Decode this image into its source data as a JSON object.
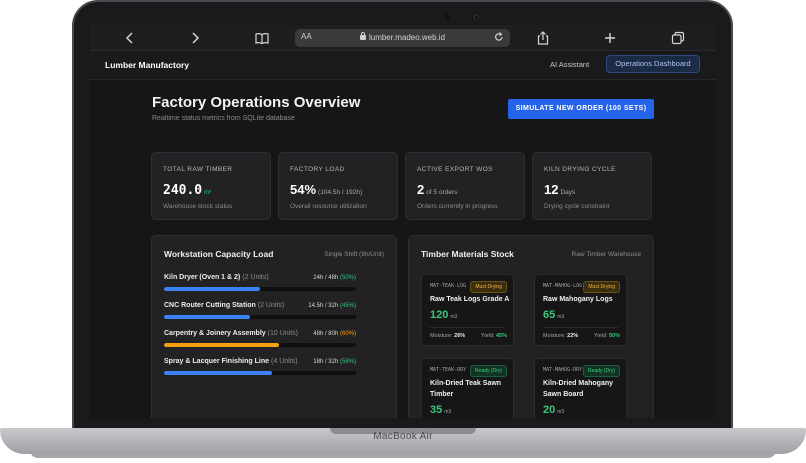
{
  "device": {
    "model_label": "MacBook Air"
  },
  "browser": {
    "text_size_label": "AA",
    "url": "lumber.madeo.web.id",
    "icons": [
      "chevron-left-icon",
      "chevron-right-icon",
      "book-icon",
      "lock-icon",
      "reload-icon",
      "share-icon",
      "plus-icon",
      "tabs-icon"
    ]
  },
  "nav": {
    "brand": "Lumber Manufactory",
    "links": [
      {
        "label": "AI Assistant",
        "active": false
      },
      {
        "label": "Operations Dashboard",
        "active": true
      }
    ]
  },
  "header": {
    "title": "Factory Operations Overview",
    "subtitle": "Realtime status metrics from SQLite database",
    "action_label": "SIMULATE NEW ORDER (100 SETS)"
  },
  "kpis": [
    {
      "label": "Total Raw Timber",
      "value": "240.0",
      "unit": "m³",
      "desc": "Warehouse stock status"
    },
    {
      "label": "Factory Load",
      "value": "54%",
      "unit": "(104.5h / 192h)",
      "desc": "Overall resource utilization"
    },
    {
      "label": "Active Export WOs",
      "value": "2",
      "unit": "of 5 orders",
      "desc": "Orders currently in progress"
    },
    {
      "label": "Kiln Drying Cycle",
      "value": "12",
      "unit": "Days",
      "desc": "Drying cycle constraint"
    }
  ],
  "workstations": {
    "title": "Workstation Capacity Load",
    "meta": "Single Shift (8h/Unit)",
    "items": [
      {
        "name": "Kiln Dryer (Oven 1 & 2)",
        "units": "(2 Units)",
        "hours": "24h / 48h",
        "pct_label": "(50%)",
        "pct": 50,
        "color": "#3b82f6",
        "status": "green"
      },
      {
        "name": "CNC Router Cutting Station",
        "units": "(2 Units)",
        "hours": "14.5h / 32h",
        "pct_label": "(45%)",
        "pct": 45,
        "color": "#3b82f6",
        "status": "green"
      },
      {
        "name": "Carpentry & Joinery Assembly",
        "units": "(10 Units)",
        "hours": "48h / 80h",
        "pct_label": "(60%)",
        "pct": 60,
        "color": "#f5a00f",
        "status": "orange"
      },
      {
        "name": "Spray & Lacquer Finishing Line",
        "units": "(4 Units)",
        "hours": "18h / 32h",
        "pct_label": "(56%)",
        "pct": 56,
        "color": "#3b82f6",
        "status": "green"
      }
    ]
  },
  "stock": {
    "title": "Timber Materials Stock",
    "meta": "Raw Timber Warehouse",
    "items": [
      {
        "code": "MAT-TEAK-LOG",
        "badge": "Must Drying",
        "badge_type": "must",
        "name": "Raw Teak Logs Grade A",
        "qty": "120",
        "unit": "m3",
        "moisture_label": "Moisture:",
        "moisture": "26%",
        "yield_label": "Yield:",
        "yield": "45%"
      },
      {
        "code": "MAT-MAHOG-LOG",
        "badge": "Must Drying",
        "badge_type": "must",
        "name": "Raw Mahogany Logs",
        "qty": "65",
        "unit": "m3",
        "moisture_label": "Moisture:",
        "moisture": "22%",
        "yield_label": "Yield:",
        "yield": "50%"
      },
      {
        "code": "MAT-TEAK-DRY",
        "badge": "Ready (Dry)",
        "badge_type": "ready",
        "name": "Kiln-Dried Teak Sawn Timber",
        "qty": "35",
        "unit": "m3"
      },
      {
        "code": "MAT-MAHOG-DRY",
        "badge": "Ready (Dry)",
        "badge_type": "ready",
        "name": "Kiln-Dried Mahogany Sawn Board",
        "qty": "20",
        "unit": "m3"
      }
    ]
  }
}
